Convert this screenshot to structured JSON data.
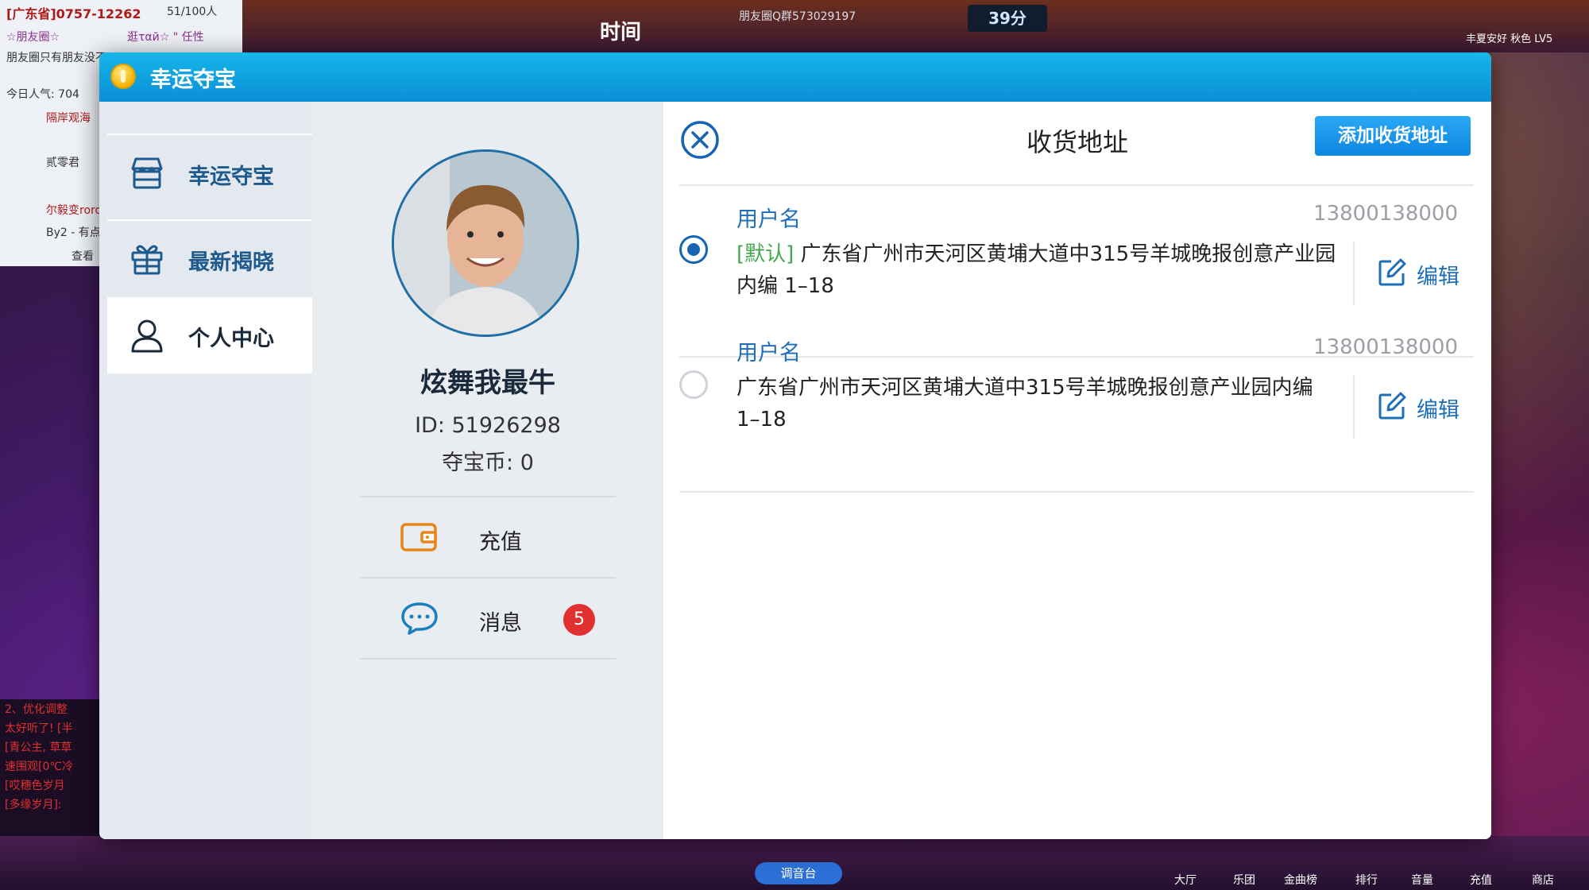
{
  "background": {
    "room_title": "[广东省]0757-12262",
    "room_count": "51/100人",
    "friend_circle": "☆朋友圈☆",
    "invite": "逛ταй☆ \" 任性",
    "friend_notice": "朋友圈只有朋友没不",
    "popularity": "今日人气: 704",
    "list_line1": "隔岸观海",
    "list_line2": "贰零君",
    "list_line3": "尔毅变roro",
    "list_line4": "By2 - 有点",
    "view_more": "查看",
    "timer_label": "时间",
    "group_info": "朋友圈Q群573029197",
    "score": "39分",
    "user_info": "丰夏安好 秋色 LV5",
    "chat_line1": "2、优化调整",
    "chat_line2": "太好听了! [半",
    "chat_line3": "[青公主, 草草",
    "chat_line4": "速围观[0℃冷",
    "chat_line5": "[哎穗色岁月",
    "chat_line6": "[多缘岁月]:",
    "tuning_button": "调音台",
    "nav_hall": "大厅",
    "nav_band": "乐团",
    "nav_hits": "金曲榜",
    "nav_rank": "排行",
    "nav_volume": "音量",
    "nav_recharge": "充值",
    "nav_shop": "商店"
  },
  "modal": {
    "title": "幸运夺宝",
    "sidebar": [
      {
        "label": "幸运夺宝",
        "icon": "store-icon"
      },
      {
        "label": "最新揭晓",
        "icon": "gift-icon"
      },
      {
        "label": "个人中心",
        "icon": "user-icon",
        "active": true
      }
    ],
    "profile": {
      "nickname": "炫舞我最牛",
      "id": "ID: 51926298",
      "coins": "夺宝币: 0",
      "menu": [
        {
          "label": "充值",
          "icon": "wallet-icon"
        },
        {
          "label": "消息",
          "icon": "chat-icon",
          "badge": "5"
        }
      ]
    },
    "address_panel": {
      "title": "收货地址",
      "add_button": "添加收货地址",
      "addresses": [
        {
          "name": "用户名",
          "phone": "13800138000",
          "default_tag": "[默认]",
          "address": " 广东省广州市天河区黄埔大道中315号羊城晚报创意产业园内编 1–18",
          "edit_label": "编辑",
          "selected": true
        },
        {
          "name": "用户名",
          "phone": "13800138000",
          "default_tag": "",
          "address": "广东省广州市天河区黄埔大道中315号羊城晚报创意产业园内编 1–18",
          "edit_label": "编辑",
          "selected": false
        }
      ]
    }
  },
  "colors": {
    "header": "#0a8fd6",
    "accent_blue": "#1e6fb8",
    "default_green": "#3fa94b",
    "badge_red": "#e13030"
  }
}
